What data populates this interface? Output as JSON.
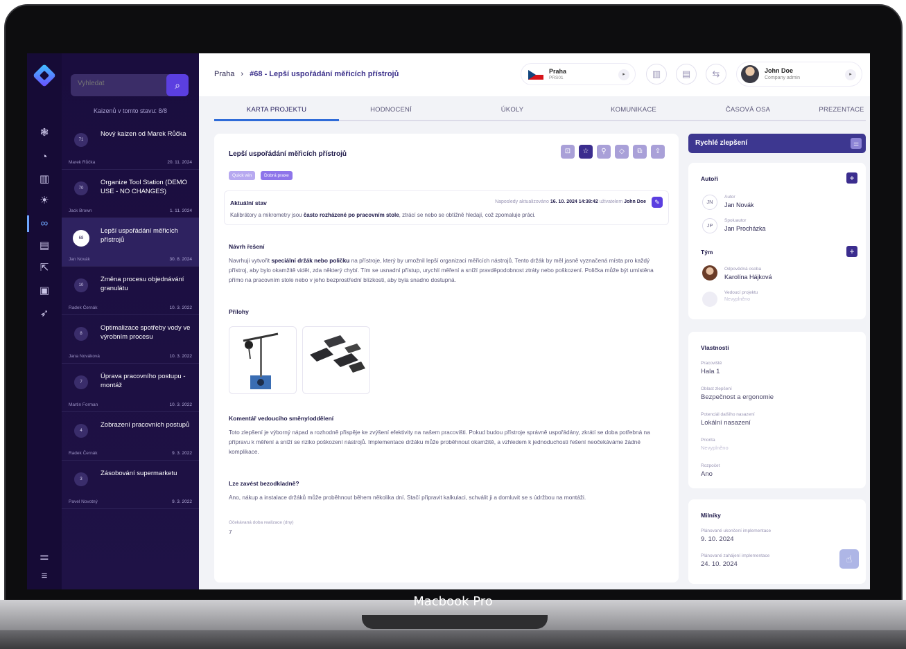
{
  "device": {
    "label": "Macbook Pro"
  },
  "search": {
    "placeholder": "Vyhledat"
  },
  "list": {
    "count_label": "Kaizenů v tomto stavu: 8/8",
    "items": [
      {
        "badge": "71",
        "title": "Nový kaizen od Marek Růčka",
        "author": "Marek Růčka",
        "date": "20. 11. 2024"
      },
      {
        "badge": "70",
        "title": "Organize Tool Station (DEMO USE - NO CHANGES)",
        "author": "Jack Brown",
        "date": "1. 11. 2024"
      },
      {
        "badge": "68",
        "title": "Lepší uspořádání měřicích přístrojů",
        "author": "Jan Novák",
        "date": "30. 8. 2024"
      },
      {
        "badge": "10",
        "title": "Změna procesu objednávání granulátu",
        "author": "Radek Černák",
        "date": "10. 3. 2022"
      },
      {
        "badge": "8",
        "title": "Optimalizace spotřeby vody ve výrobním procesu",
        "author": "Jana Nováková",
        "date": "10. 3. 2022"
      },
      {
        "badge": "7",
        "title": "Úprava pracovního postupu - montáž",
        "author": "Martin Forman",
        "date": "10. 3. 2022"
      },
      {
        "badge": "4",
        "title": "Zobrazení pracovních postupů",
        "author": "Radek Černák",
        "date": "9. 3. 2022"
      },
      {
        "badge": "3",
        "title": "Zásobování supermarketu",
        "author": "Pavel Novotný",
        "date": "9. 3. 2022"
      }
    ]
  },
  "header": {
    "breadcrumb_root": "Praha",
    "breadcrumb_sep": "›",
    "breadcrumb_current": "#68 - Lepší uspořádání měřicích přístrojů",
    "location_name": "Praha",
    "location_code": "PRS01",
    "user_name": "John Doe",
    "user_role": "Company admin"
  },
  "tabs": [
    "KARTA PROJEKTU",
    "HODNOCENÍ",
    "ÚKOLY",
    "KOMUNIKACE",
    "ČASOVÁ OSA",
    "PREZENTACE"
  ],
  "project": {
    "title": "Lepší uspořádání měřicích přístrojů",
    "tags": [
      "Quick win",
      "Dobrá praxe"
    ],
    "state_label": "Aktuální stav",
    "updated_prefix": "Naposledy aktualizováno",
    "updated_at": "16. 10. 2024 14:38:42",
    "updated_by_prefix": "uživatelem",
    "updated_by": "John Doe",
    "state_text_1": "Kalibrátory a mikrometry jsou",
    "state_text_bold": "často rozházené po pracovním stole",
    "state_text_2": ", ztrácí se nebo se obtížně hledají, což zpomaluje práci.",
    "solution_label": "Návrh řešení",
    "solution_text_1": "Navrhuji vytvořit",
    "solution_text_bold": "speciální držák nebo poličku",
    "solution_text_2": " na přístroje, který by umožnil lepší organizaci měřicích nástrojů. Tento držák by měl jasně vyznačená místa pro každý přístroj, aby bylo okamžitě vidět, zda některý chybí. Tím se usnadní přístup, urychlí měření a sníží pravděpodobnost ztráty nebo poškození. Polička může být umístěna přímo na pracovním stole nebo v jeho bezprostřední blízkosti, aby byla snadno dostupná.",
    "attachments_label": "Přílohy",
    "comment_label": "Komentář vedoucího směny/oddělení",
    "comment_text": "Toto zlepšení je výborný nápad a rozhodně přispěje ke zvýšení efektivity na našem pracovišti. Pokud budou přístroje správně uspořádány, zkrátí se doba potřebná na přípravu k měření a sníží se riziko poškození nástrojů. Implementace držáku může proběhnout okamžitě, a vzhledem k jednoduchosti řešení neočekáváme žádné komplikace.",
    "free_label": "Lze zavést bezodkladně?",
    "free_text": "Ano, nákup a instalace držáků může proběhnout během několika dní. Stačí připravit kalkulaci, schválit ji a domluvit se s údržbou na montáži.",
    "duration_label": "Očekávaná doba realizace (dny)",
    "duration_value": "7"
  },
  "quick": {
    "title": "Rychlé zlepšení"
  },
  "authors": {
    "title": "Autoři",
    "people": [
      {
        "initials": "JN",
        "role": "Autor",
        "name": "Jan Novák"
      },
      {
        "initials": "JP",
        "role": "Spoluautor",
        "name": "Jan Procházka"
      }
    ]
  },
  "team": {
    "title": "Tým",
    "responsible_role": "Odpovědná osoba",
    "responsible_name": "Karolína Hájková",
    "lead_role": "Vedoucí projektu",
    "lead_name": "Nevyplněno"
  },
  "props": {
    "title": "Vlastnosti",
    "items": [
      {
        "label": "Pracoviště",
        "value": "Hala 1"
      },
      {
        "label": "Oblast zlepšení",
        "value": "Bezpečnost a ergonomie"
      },
      {
        "label": "Potenciál dalšího nasazení",
        "value": "Lokální nasazení"
      },
      {
        "label": "Priorita",
        "value": "Nevyplněno"
      },
      {
        "label": "Rozpočet",
        "value": "Ano"
      }
    ]
  },
  "milestones": {
    "title": "Milníky",
    "items": [
      {
        "label": "Plánované ukončení implementace",
        "value": "9. 10. 2024"
      },
      {
        "label": "Plánované zahájení implementace",
        "value": "24. 10. 2024"
      }
    ]
  },
  "colors": {
    "sidebar": "#160b36",
    "accent": "#5b3fe0",
    "quick_bar": "#3d3790",
    "tab_underline": "#2f6bd8"
  },
  "icons": [
    "logo-icon",
    "rail-dashboard-icon",
    "rail-chart-icon",
    "rail-barcode-icon",
    "rail-idea-icon",
    "rail-kaizen-icon",
    "rail-clipboard-icon",
    "rail-export-icon",
    "rail-audit-icon",
    "rail-rocket-icon",
    "rail-settings-icon",
    "rail-menu-icon",
    "search-icon",
    "barcode-icon",
    "clipboard-icon",
    "signpost-icon"
  ]
}
